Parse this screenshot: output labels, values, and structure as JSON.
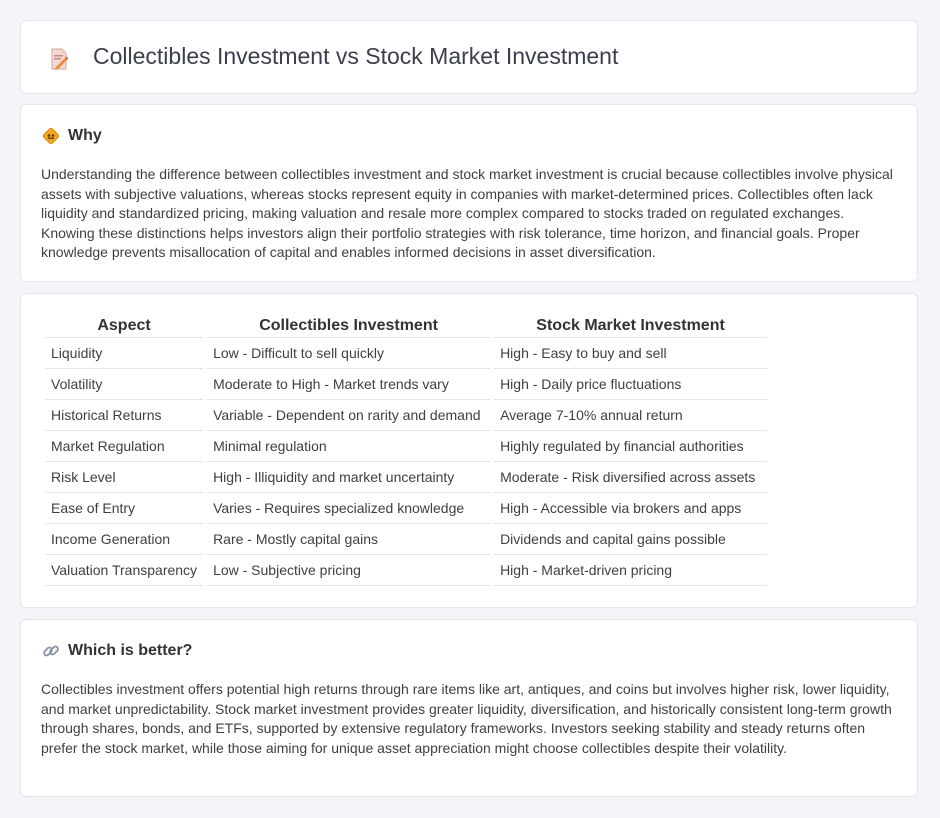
{
  "header": {
    "title": "Collectibles Investment vs Stock Market Investment",
    "icon": "document-pencil-icon"
  },
  "why": {
    "heading": "Why",
    "icon": "diamond-road-sign-icon",
    "text": "Understanding the difference between collectibles investment and stock market investment is crucial because collectibles involve physical assets with subjective valuations, whereas stocks represent equity in companies with market-determined prices. Collectibles often lack liquidity and standardized pricing, making valuation and resale more complex compared to stocks traded on regulated exchanges. Knowing these distinctions helps investors align their portfolio strategies with risk tolerance, time horizon, and financial goals. Proper knowledge prevents misallocation of capital and enables informed decisions in asset diversification."
  },
  "table": {
    "headers": [
      "Aspect",
      "Collectibles Investment",
      "Stock Market Investment"
    ],
    "rows": [
      [
        "Liquidity",
        "Low - Difficult to sell quickly",
        "High - Easy to buy and sell"
      ],
      [
        "Volatility",
        "Moderate to High - Market trends vary",
        "High - Daily price fluctuations"
      ],
      [
        "Historical Returns",
        "Variable - Dependent on rarity and demand",
        "Average 7-10% annual return"
      ],
      [
        "Market Regulation",
        "Minimal regulation",
        "Highly regulated by financial authorities"
      ],
      [
        "Risk Level",
        "High - Illiquidity and market uncertainty",
        "Moderate - Risk diversified across assets"
      ],
      [
        "Ease of Entry",
        "Varies - Requires specialized knowledge",
        "High - Accessible via brokers and apps"
      ],
      [
        "Income Generation",
        "Rare - Mostly capital gains",
        "Dividends and capital gains possible"
      ],
      [
        "Valuation Transparency",
        "Low - Subjective pricing",
        "High - Market-driven pricing"
      ]
    ]
  },
  "better": {
    "heading": "Which is better?",
    "icon": "link-icon",
    "text": "Collectibles investment offers potential high returns through rare items like art, antiques, and coins but involves higher risk, lower liquidity, and market unpredictability. Stock market investment provides greater liquidity, diversification, and historically consistent long-term growth through shares, bonds, and ETFs, supported by extensive regulatory frameworks. Investors seeking stability and steady returns often prefer the stock market, while those aiming for unique asset appreciation might choose collectibles despite their volatility."
  }
}
